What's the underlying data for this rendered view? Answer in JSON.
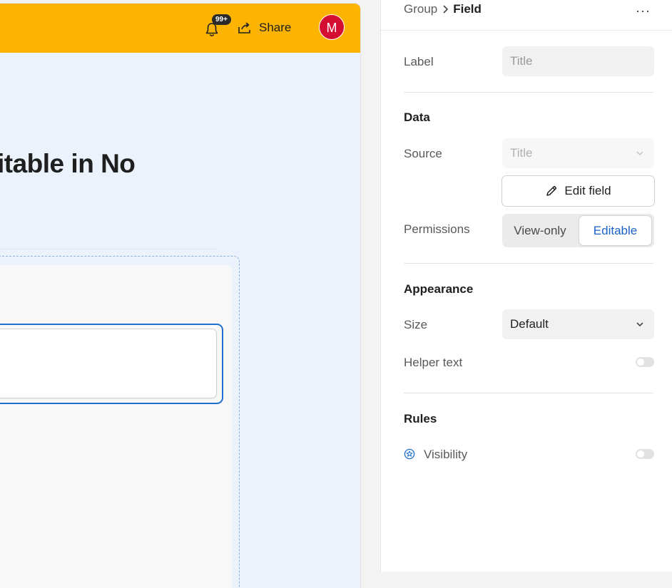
{
  "header": {
    "notifications_badge": "99+",
    "share_label": "Share",
    "avatar_initial": "M",
    "brand_color": "#fcb400"
  },
  "canvas": {
    "page_title": "itable in No"
  },
  "panel": {
    "breadcrumb": {
      "parent": "Group",
      "current": "Field"
    },
    "more_label": "···",
    "label_field": {
      "label": "Label",
      "placeholder": "Title"
    },
    "data_section": {
      "title": "Data",
      "source": {
        "label": "Source",
        "value": "Title"
      },
      "edit_field_label": "Edit field",
      "permissions": {
        "label": "Permissions",
        "options": [
          "View-only",
          "Editable"
        ],
        "selected": "Editable"
      }
    },
    "appearance_section": {
      "title": "Appearance",
      "size": {
        "label": "Size",
        "value": "Default"
      },
      "helper_text": {
        "label": "Helper text",
        "enabled": false
      }
    },
    "rules_section": {
      "title": "Rules",
      "visibility": {
        "label": "Visibility",
        "enabled": false
      }
    }
  }
}
